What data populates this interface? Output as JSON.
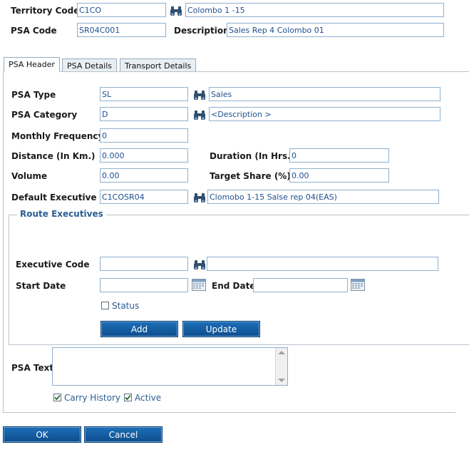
{
  "header": {
    "territory_code_label": "Territory Code",
    "territory_code_value": "C1CO",
    "territory_desc_value": "Colombo 1 -15",
    "psa_code_label": "PSA Code",
    "psa_code_value": "SR04C001",
    "description_label": "Description",
    "description_value": "Sales Rep 4 Colombo 01"
  },
  "tabs": [
    {
      "label": "PSA Header",
      "active": true
    },
    {
      "label": "PSA Details",
      "active": false
    },
    {
      "label": "Transport Details",
      "active": false
    }
  ],
  "form": {
    "psa_type_label": "PSA Type",
    "psa_type_code": "SL",
    "psa_type_desc": "Sales",
    "psa_category_label": "PSA Category",
    "psa_category_code": "D",
    "psa_category_desc": "<Description >",
    "monthly_frequency_label": "Monthly Frequency",
    "monthly_frequency_value": "0",
    "distance_label": "Distance (In Km.)",
    "distance_value": "0.000",
    "duration_label": "Duration (In Hrs.)",
    "duration_value": "0",
    "volume_label": "Volume",
    "volume_value": "0.00",
    "target_share_label": "Target Share (%)",
    "target_share_value": "0.00",
    "default_executive_label": "Default Executive",
    "default_executive_code": "C1COSR04",
    "default_executive_desc": "Clomobo 1-15 Salse rep 04(EAS)"
  },
  "route_executives": {
    "legend": "Route Executives",
    "executive_code_label": "Executive Code",
    "executive_code_value": "",
    "executive_desc_value": "",
    "start_date_label": "Start Date",
    "start_date_value": "",
    "end_date_label": "End Date",
    "end_date_value": "",
    "status_label": "Status",
    "status_checked": false,
    "add_label": "Add",
    "update_label": "Update"
  },
  "psa_text": {
    "label": "PSA Text",
    "value": ""
  },
  "flags": {
    "carry_history_label": "Carry History",
    "carry_history_checked": true,
    "active_label": "Active",
    "active_checked": true
  },
  "footer": {
    "ok_label": "OK",
    "cancel_label": "Cancel"
  },
  "colors": {
    "button_blue": "#0d4d8c",
    "input_text": "#1f4f8f",
    "legend_text": "#2a5d93"
  }
}
